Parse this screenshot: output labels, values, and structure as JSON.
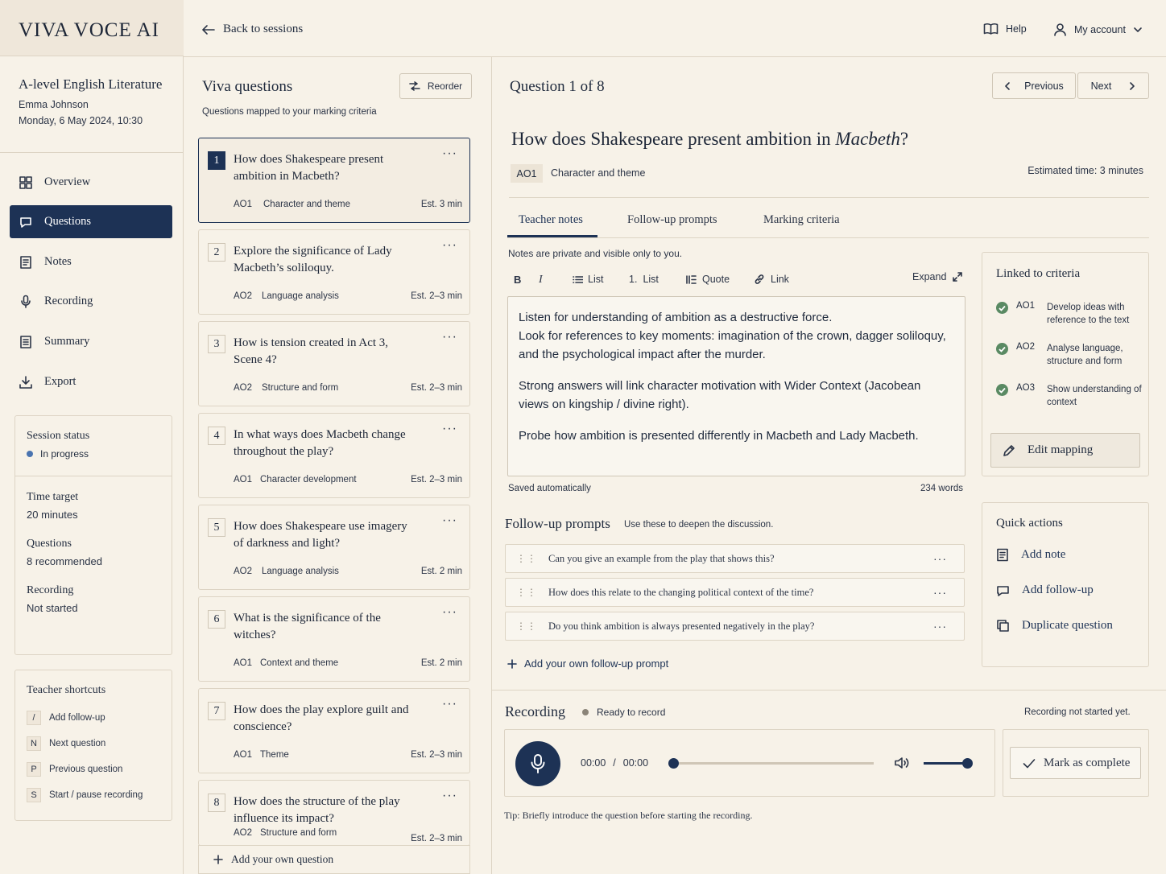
{
  "app": {
    "brand": "VIVA VOCE AI"
  },
  "topbar": {
    "back": "Back to sessions",
    "help": "Help",
    "account": "My account"
  },
  "session": {
    "course": "A-level English Literature",
    "student": "Emma Johnson",
    "datetime": "Monday, 6 May 2024, 10:30"
  },
  "nav": [
    {
      "label": "Overview",
      "icon": "grid-icon"
    },
    {
      "label": "Questions",
      "icon": "chat-icon"
    },
    {
      "label": "Notes",
      "icon": "note-icon"
    },
    {
      "label": "Recording",
      "icon": "mic-icon"
    },
    {
      "label": "Summary",
      "icon": "summary-icon"
    },
    {
      "label": "Export",
      "icon": "download-icon"
    }
  ],
  "status": {
    "label": "Session status",
    "value": "In progress",
    "time_label": "Time target",
    "time_value": "20 minutes",
    "questions_label": "Questions",
    "questions_value": "8 recommended",
    "recording_label": "Recording",
    "recording_value": "Not started"
  },
  "shortcuts": {
    "title": "Teacher shortcuts",
    "items": [
      {
        "key": "/",
        "label": "Add follow-up"
      },
      {
        "key": "N",
        "label": "Next question"
      },
      {
        "key": "P",
        "label": "Previous question"
      },
      {
        "key": "S",
        "label": "Start / pause recording"
      }
    ]
  },
  "questions_panel": {
    "title": "Viva questions",
    "subtitle": "Questions mapped to your marking criteria",
    "reorder": "Reorder",
    "add_own": "Add your own question",
    "items": [
      {
        "n": "1",
        "title": "How does Shakespeare present ambition in Macbeth?",
        "ao": "AO1",
        "theme": "Character and theme",
        "est": "Est. 3 min"
      },
      {
        "n": "2",
        "title": "Explore the significance of Lady Macbeth’s soliloquy.",
        "ao": "AO2",
        "theme": "Language analysis",
        "est": "Est. 2–3 min"
      },
      {
        "n": "3",
        "title": "How is tension created in Act 3, Scene 4?",
        "ao": "AO2",
        "theme": "Structure and form",
        "est": "Est. 2–3 min"
      },
      {
        "n": "4",
        "title": "In what ways does Macbeth change throughout the play?",
        "ao": "AO1",
        "theme": "Character development",
        "est": "Est. 2–3 min"
      },
      {
        "n": "5",
        "title": "How does Shakespeare use imagery of darkness and light?",
        "ao": "AO2",
        "theme": "Language analysis",
        "est": "Est. 2 min"
      },
      {
        "n": "6",
        "title": "What is the significance of the witches?",
        "ao": "AO1",
        "theme": "Context and theme",
        "est": "Est. 2 min"
      },
      {
        "n": "7",
        "title": "How does the play explore guilt and conscience?",
        "ao": "AO1",
        "theme": "Theme",
        "est": "Est. 2–3 min"
      },
      {
        "n": "8",
        "title": "How does the structure of the play influence its impact?",
        "ao": "AO2",
        "theme": "Structure and form",
        "est": "Est. 2–3 min"
      }
    ]
  },
  "main": {
    "counter": "Question 1 of 8",
    "previous": "Previous",
    "next": "Next",
    "question_prefix": "How does Shakespeare present ambition in ",
    "question_italic": "Macbeth",
    "question_suffix": "?",
    "ao": "AO1",
    "theme": "Character and theme",
    "estimated": "Estimated time: 3 minutes",
    "tabs": [
      "Teacher notes",
      "Follow-up prompts",
      "Marking criteria"
    ],
    "notes_private": "Notes are private and visible only to you.",
    "toolbar": {
      "bold": "B",
      "italic": "I",
      "list": "List",
      "numbered_prefix": "1.",
      "numbered": "List",
      "quote": "Quote",
      "link": "Link",
      "expand": "Expand"
    },
    "notes": [
      "Listen for understanding of ambition as a destructive force.\nLook for references to key moments: imagination of the crown, dagger soliloquy, and the psychological impact after the murder.",
      "Strong answers will link character motivation with Wider Context (Jacobean views on kingship / divine right).",
      "Probe how ambition is presented differently in Macbeth and Lady Macbeth."
    ],
    "saved": "Saved automatically",
    "words": "234 words",
    "followup_title": "Follow-up prompts",
    "followup_sub": "Use these to deepen the discussion.",
    "followups": [
      "Can you give an example from the play that shows this?",
      "How does this relate to the changing political context of the time?",
      "Do you think ambition is always presented negatively in the play?"
    ],
    "add_followup": "Add your own follow-up prompt"
  },
  "criteria": {
    "title": "Linked to criteria",
    "items": [
      {
        "code": "AO1",
        "desc": "Develop ideas with reference to the text"
      },
      {
        "code": "AO2",
        "desc": "Analyse language, structure and form"
      },
      {
        "code": "AO3",
        "desc": "Show understanding of context"
      }
    ],
    "edit": "Edit mapping"
  },
  "quick_actions": {
    "title": "Quick actions",
    "add_note": "Add note",
    "add_followup": "Add follow-up",
    "duplicate": "Duplicate question"
  },
  "recording": {
    "title": "Recording",
    "status": "Ready to record",
    "not_started": "Recording not started yet.",
    "current": "00:00",
    "sep": "/",
    "total": "00:00",
    "progress": 0,
    "volume": 1.0,
    "mark_complete": "Mark as complete",
    "tip_label": "Tip:",
    "tip": "Briefly introduce the question before starting the recording."
  },
  "colors": {
    "accent": "#1d3255",
    "background": "#f7f2e8",
    "check": "#5a8a63"
  }
}
